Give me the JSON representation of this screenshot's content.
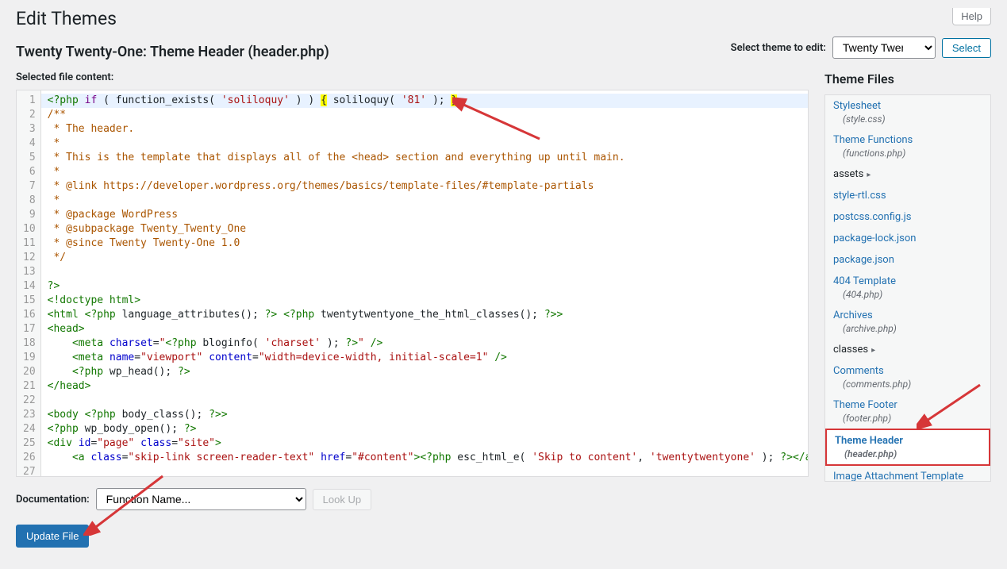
{
  "header": {
    "help_label": "Help",
    "page_title": "Edit Themes",
    "subtitle": "Twenty Twenty-One: Theme Header (header.php)",
    "select_label": "Select theme to edit:",
    "theme_selected": "Twenty Twenty-One",
    "select_btn": "Select",
    "content_label": "Selected file content:"
  },
  "sidebar": {
    "title": "Theme Files",
    "items": [
      {
        "label": "Stylesheet",
        "sub": "(style.css)",
        "type": "link"
      },
      {
        "label": "Theme Functions",
        "sub": "(functions.php)",
        "type": "link"
      },
      {
        "label": "assets",
        "type": "folder"
      },
      {
        "label": "style-rtl.css",
        "type": "link"
      },
      {
        "label": "postcss.config.js",
        "type": "link"
      },
      {
        "label": "package-lock.json",
        "type": "link"
      },
      {
        "label": "package.json",
        "type": "link"
      },
      {
        "label": "404 Template",
        "sub": "(404.php)",
        "type": "link"
      },
      {
        "label": "Archives",
        "sub": "(archive.php)",
        "type": "link"
      },
      {
        "label": "classes",
        "type": "folder"
      },
      {
        "label": "Comments",
        "sub": "(comments.php)",
        "type": "link"
      },
      {
        "label": "Theme Footer",
        "sub": "(footer.php)",
        "type": "link"
      },
      {
        "label": "Theme Header",
        "sub": "(header.php)",
        "type": "link",
        "selected": true
      },
      {
        "label": "Image Attachment Template",
        "type": "link"
      }
    ]
  },
  "code_lines": [
    {
      "html": "<span class='t-tag'>&lt;?php</span> <span class='t-kw'>if</span> ( function_exists( <span class='t-str'>'soliloquy'</span> ) ) <span class='t-brace'>{</span> soliloquy( <span class='t-str'>'81'</span> ); <span class='t-brace'>}</span>",
      "hl": true
    },
    {
      "html": "<span class='t-com'>/**</span>"
    },
    {
      "html": "<span class='t-com'> * The header.</span>"
    },
    {
      "html": "<span class='t-com'> *</span>"
    },
    {
      "html": "<span class='t-com'> * This is the template that displays all of the &lt;head&gt; section and everything up until main.</span>"
    },
    {
      "html": "<span class='t-com'> *</span>"
    },
    {
      "html": "<span class='t-com'> * @link https://developer.wordpress.org/themes/basics/template-files/#template-partials</span>"
    },
    {
      "html": "<span class='t-com'> *</span>"
    },
    {
      "html": "<span class='t-com'> * @package WordPress</span>"
    },
    {
      "html": "<span class='t-com'> * @subpackage Twenty_Twenty_One</span>"
    },
    {
      "html": "<span class='t-com'> * @since Twenty Twenty-One 1.0</span>"
    },
    {
      "html": "<span class='t-com'> */</span>"
    },
    {
      "html": ""
    },
    {
      "html": "<span class='t-tag'>?&gt;</span>"
    },
    {
      "html": "<span class='t-tag'>&lt;!doctype html&gt;</span>"
    },
    {
      "html": "<span class='t-tag'>&lt;html</span> <span class='t-tag'>&lt;?php</span> language_attributes(); <span class='t-tag'>?&gt;</span> <span class='t-tag'>&lt;?php</span> twentytwentyone_the_html_classes(); <span class='t-tag'>?&gt;</span><span class='t-tag'>&gt;</span>"
    },
    {
      "html": "<span class='t-tag'>&lt;head&gt;</span>"
    },
    {
      "html": "    <span class='t-tag'>&lt;meta</span> <span class='t-attr'>charset</span>=<span class='t-str'>\"</span><span class='t-tag'>&lt;?php</span> bloginfo( <span class='t-str'>'charset'</span> ); <span class='t-tag'>?&gt;</span><span class='t-str'>\"</span> <span class='t-tag'>/&gt;</span>"
    },
    {
      "html": "    <span class='t-tag'>&lt;meta</span> <span class='t-attr'>name</span>=<span class='t-str'>\"viewport\"</span> <span class='t-attr'>content</span>=<span class='t-str'>\"width=device-width, initial-scale=1\"</span> <span class='t-tag'>/&gt;</span>"
    },
    {
      "html": "    <span class='t-tag'>&lt;?php</span> wp_head(); <span class='t-tag'>?&gt;</span>"
    },
    {
      "html": "<span class='t-tag'>&lt;/head&gt;</span>"
    },
    {
      "html": ""
    },
    {
      "html": "<span class='t-tag'>&lt;body</span> <span class='t-tag'>&lt;?php</span> body_class(); <span class='t-tag'>?&gt;</span><span class='t-tag'>&gt;</span>"
    },
    {
      "html": "<span class='t-tag'>&lt;?php</span> wp_body_open(); <span class='t-tag'>?&gt;</span>"
    },
    {
      "html": "<span class='t-tag'>&lt;div</span> <span class='t-attr'>id</span>=<span class='t-str'>\"page\"</span> <span class='t-attr'>class</span>=<span class='t-str'>\"site\"</span><span class='t-tag'>&gt;</span>"
    },
    {
      "html": "    <span class='t-tag'>&lt;a</span> <span class='t-attr'>class</span>=<span class='t-str'>\"skip-link screen-reader-text\"</span> <span class='t-attr'>href</span>=<span class='t-str'>\"#content\"</span><span class='t-tag'>&gt;</span><span class='t-tag'>&lt;?php</span> esc_html_e( <span class='t-str'>'Skip to content'</span>, <span class='t-str'>'twentytwentyone'</span> ); <span class='t-tag'>?&gt;</span><span class='t-tag'>&lt;/a&gt;</span>"
    },
    {
      "html": ""
    }
  ],
  "footer": {
    "doc_label": "Documentation:",
    "func_placeholder": "Function Name...",
    "lookup_label": "Look Up",
    "update_label": "Update File"
  }
}
